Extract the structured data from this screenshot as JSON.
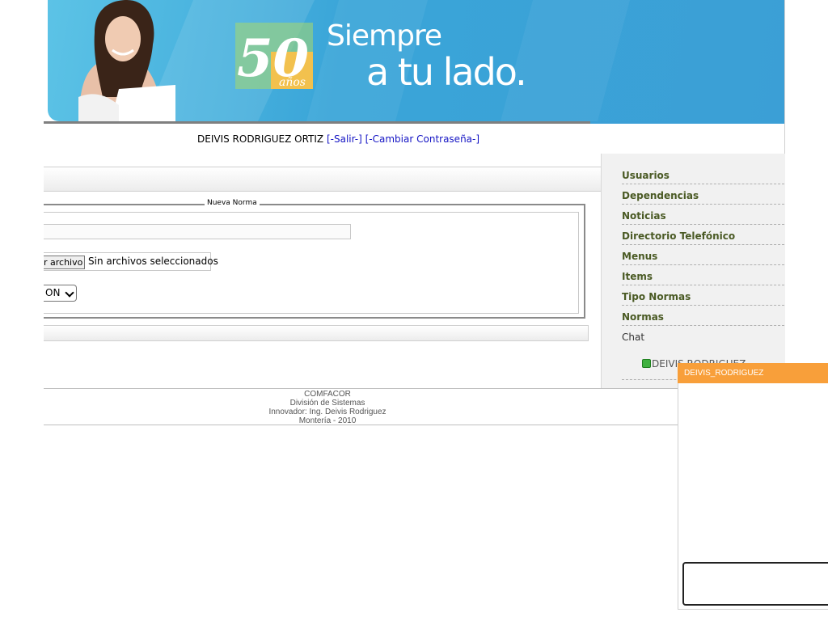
{
  "banner": {
    "logo_number": "50",
    "logo_sub": "años",
    "slogan_line1": "Siempre",
    "slogan_line2": "a tu lado."
  },
  "user": {
    "name": "DEIVIS RODRIGUEZ ORTIZ",
    "logout_link": "[-Salir-]",
    "change_password_link": "[-Cambiar Contraseña-]"
  },
  "form": {
    "legend": "Nueva Norma",
    "file_button": "r archivo",
    "file_status": "Sin archivos seleccionados",
    "select_value": "ON"
  },
  "sidebar": {
    "items": [
      {
        "label": "Usuarios"
      },
      {
        "label": "Dependencias"
      },
      {
        "label": "Noticias"
      },
      {
        "label": "Directorio Telefónico"
      },
      {
        "label": "Menus"
      },
      {
        "label": "Items"
      },
      {
        "label": "Tipo Normas"
      },
      {
        "label": "Normas"
      }
    ],
    "chat_label": "Chat",
    "online_user": "DEIVIS RODRIGUEZ"
  },
  "footer": {
    "line1": "COMFACOR",
    "line2": "División de Sistemas",
    "line3": "Innovador: Ing. Deivis Rodriguez",
    "line4": "Montería - 2010"
  },
  "chat": {
    "title": "DEIVIS_RODRIGUEZ"
  },
  "colors": {
    "banner_blue": "#3b9fd6",
    "menu_text": "#4a5a24",
    "link_blue": "#1515c4",
    "chat_header": "#f89f3a",
    "online_green": "#3fb13f"
  },
  "icons": [
    "online-status-icon",
    "chevron-down-icon"
  ]
}
